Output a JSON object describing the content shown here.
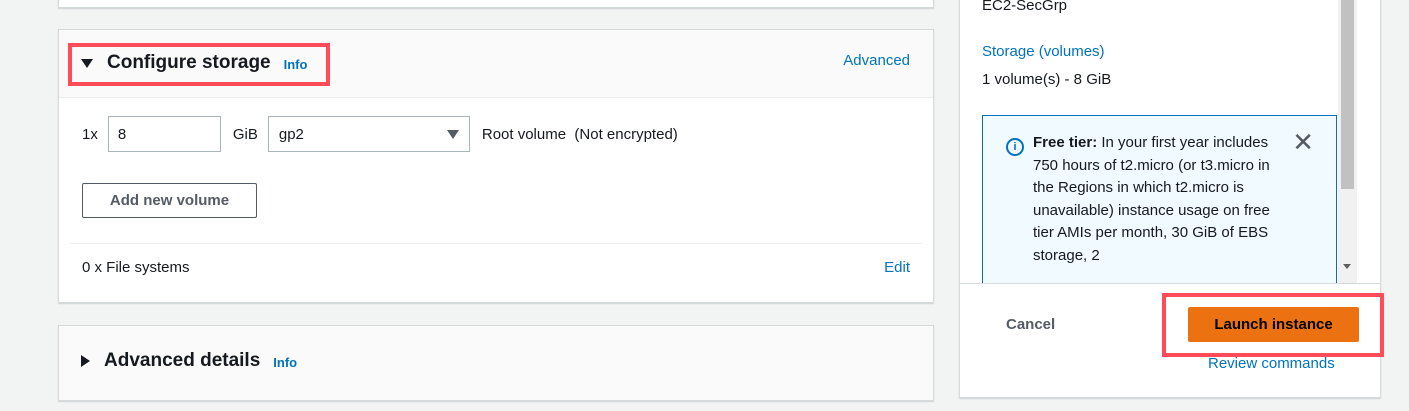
{
  "storage": {
    "title": "Configure storage",
    "info_label": "Info",
    "advanced_label": "Advanced",
    "volume": {
      "count": "1x",
      "size": "8",
      "unit": "GiB",
      "type": "gp2",
      "description": "Root volume  (Not encrypted)"
    },
    "add_volume_label": "Add new volume",
    "file_systems_label": "0 x File systems",
    "edit_label": "Edit"
  },
  "advanced_details": {
    "title": "Advanced details",
    "info_label": "Info"
  },
  "summary": {
    "security_group": "EC2-SecGrp",
    "storage_label": "Storage (volumes)",
    "storage_value": "1 volume(s) - 8 GiB",
    "free_tier_alert": {
      "bold_label": "Free tier:",
      "text": " In your first year includes 750 hours of t2.micro (or t3.micro in the Regions in which t2.micro is unavailable) instance usage on free tier AMIs per month, 30 GiB of EBS storage, 2"
    },
    "cancel_label": "Cancel",
    "launch_label": "Launch instance",
    "review_label": "Review commands"
  },
  "colors": {
    "accent": "#0073bb",
    "primary_button": "#ec7211",
    "highlight": "#ff4c58"
  }
}
